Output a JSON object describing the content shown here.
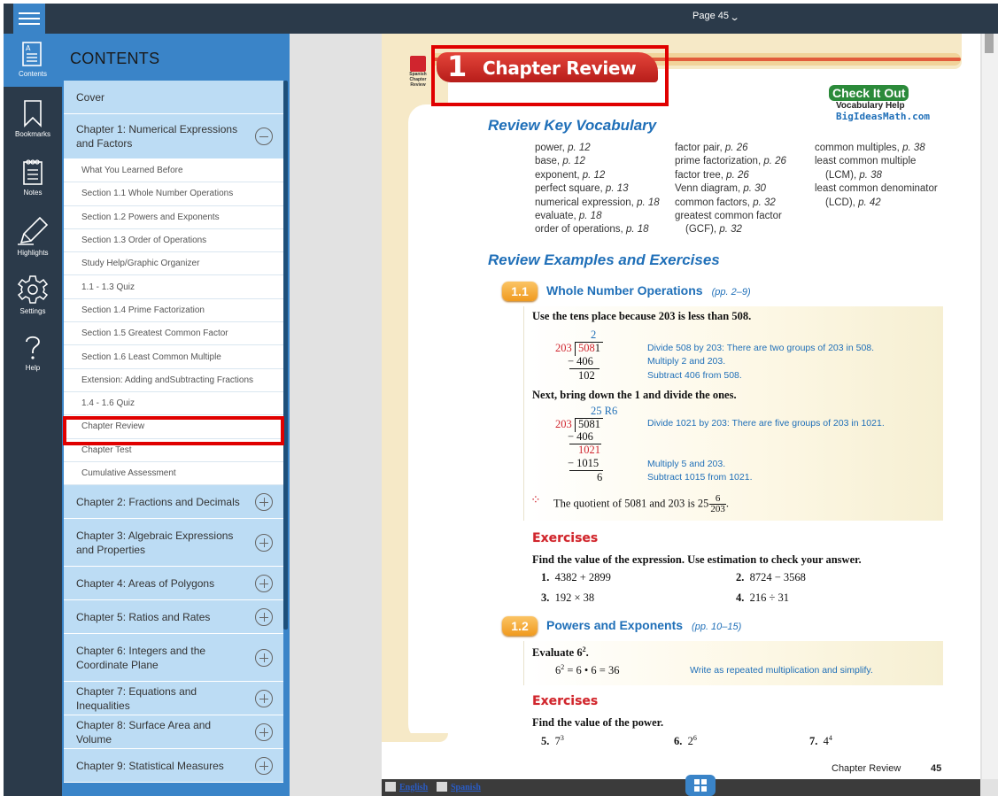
{
  "topbar": {
    "menu_icon": "hamburger-menu-icon",
    "page_label": "Page 45"
  },
  "rail": {
    "items": [
      {
        "label": "Contents",
        "icon": "contents-icon"
      },
      {
        "label": "Bookmarks",
        "icon": "bookmark-icon"
      },
      {
        "label": "Notes",
        "icon": "notes-icon"
      },
      {
        "label": "Highlights",
        "icon": "pencil-icon"
      },
      {
        "label": "Settings",
        "icon": "gear-icon"
      },
      {
        "label": "Help",
        "icon": "question-icon"
      }
    ],
    "active_color": "#3a84c8"
  },
  "contents": {
    "title": "CONTENTS",
    "cover": "Cover",
    "chapter1": {
      "label": "Chapter 1: Numerical Expressions and Factors",
      "sections": [
        "What You Learned Before",
        "Section 1.1 Whole Number Operations",
        "Section 1.2 Powers and Exponents",
        "Section 1.3 Order of Operations",
        "Study Help/Graphic Organizer",
        "1.1 - 1.3 Quiz",
        "Section 1.4 Prime Factorization",
        "Section 1.5 Greatest Common Factor",
        "Section 1.6 Least Common Multiple",
        "Extension: Adding andSubtracting Fractions",
        "1.4 - 1.6 Quiz",
        "Chapter Review",
        "Chapter Test",
        "Cumulative Assessment"
      ]
    },
    "chapters": [
      "Chapter 2: Fractions and Decimals",
      "Chapter 3: Algebraic Expressions and Properties",
      "Chapter 4: Areas of Polygons",
      "Chapter 5: Ratios and Rates",
      "Chapter 6: Integers and the Coordinate Plane",
      "Chapter 7: Equations and Inequalities",
      "Chapter 8: Surface Area and Volume",
      "Chapter 9: Statistical Measures"
    ],
    "highlighted_item": "Chapter Review"
  },
  "book_page": {
    "spanish_label": "Spanish Chapter Review",
    "chapter_number": "1",
    "chapter_title": "Chapter Review",
    "check_it_out": {
      "title": "Check It Out",
      "sub": "Vocabulary Help",
      "site": "BigIdeasMath.com"
    },
    "vocab_heading": "Review Key Vocabulary",
    "vocab": [
      [
        {
          "term": "power,",
          "page": "p. 12"
        },
        {
          "term": "base,",
          "page": "p. 12"
        },
        {
          "term": "exponent,",
          "page": "p. 12"
        },
        {
          "term": "perfect square,",
          "page": "p. 13"
        },
        {
          "term": "numerical expression,",
          "page": "p. 18"
        },
        {
          "term": "evaluate,",
          "page": "p. 18"
        },
        {
          "term": "order of operations,",
          "page": "p. 18"
        }
      ],
      [
        {
          "term": "factor pair,",
          "page": "p. 26"
        },
        {
          "term": "prime factorization,",
          "page": "p. 26"
        },
        {
          "term": "factor tree,",
          "page": "p. 26"
        },
        {
          "term": "Venn diagram,",
          "page": "p. 30"
        },
        {
          "term": "common factors,",
          "page": "p. 32"
        },
        {
          "term": "greatest common factor",
          "page": ""
        },
        {
          "term": "   (GCF),",
          "page": "p. 32"
        }
      ],
      [
        {
          "term": "common multiples,",
          "page": "p. 38"
        },
        {
          "term": "least common multiple",
          "page": ""
        },
        {
          "term": "   (LCM),",
          "page": "p. 38"
        },
        {
          "term": "least common denominator",
          "page": ""
        },
        {
          "term": "   (LCD),",
          "page": "p. 42"
        }
      ]
    ],
    "examples_heading": "Review Examples and Exercises",
    "lesson1": {
      "number": "1.1",
      "title": "Whole Number Operations",
      "pages": "(pp. 2–9)",
      "intro": "Use the tens place because 203 is less than 508.",
      "step1": {
        "quotient": "2",
        "divisor": "203",
        "dividend_lead": "508",
        "dividend_rest": "1",
        "sub": "− 406",
        "remainder": "102",
        "notes": [
          "Divide 508 by 203: There are two groups of 203 in 508.",
          "Multiply 2 and 203.",
          "Subtract 406 from 508."
        ]
      },
      "intro2": "Next, bring down the 1 and divide the ones.",
      "step2": {
        "quotient": "25 R6",
        "divisor": "203",
        "dividend": "5081",
        "sub1": "− 406",
        "brought": "1021",
        "sub2": "− 1015",
        "remainder": "6",
        "notes": [
          "Divide 1021 by 203: There are five groups of 203 in 1021.",
          "Multiply 5 and 203.",
          "Subtract 1015 from 1021."
        ]
      },
      "conclusion": "The quotient of 5081 and 203 is 25",
      "conclusion_frac_num": "6",
      "conclusion_frac_den": "203",
      "exercises_heading": "Exercises",
      "exercises_prompt": "Find the value of the expression. Use estimation to check your answer.",
      "exercises": [
        {
          "n": "1.",
          "expr": "4382 + 2899"
        },
        {
          "n": "2.",
          "expr": "8724 − 3568"
        },
        {
          "n": "3.",
          "expr": "192 × 38"
        },
        {
          "n": "4.",
          "expr": "216 ÷ 31"
        }
      ]
    },
    "lesson2": {
      "number": "1.2",
      "title": "Powers and Exponents",
      "pages": "(pp. 10–15)",
      "intro": "Evaluate 6",
      "intro_exp": "2",
      "work": "6",
      "work_exp": "2",
      "work_rest": " = 6 • 6 = 36",
      "note": "Write as repeated multiplication and simplify.",
      "exercises_heading": "Exercises",
      "exercises_prompt": "Find the value of the power.",
      "exercises": [
        {
          "n": "5.",
          "base": "7",
          "exp": "3"
        },
        {
          "n": "6.",
          "base": "2",
          "exp": "6"
        },
        {
          "n": "7.",
          "base": "4",
          "exp": "4"
        }
      ]
    },
    "footer_label": "Chapter Review",
    "footer_page": "45"
  },
  "bottom_bar": {
    "english": "English",
    "spanish": "Spanish",
    "grid_icon": "grid-icon"
  },
  "colors": {
    "topbar": "#2b3a4a",
    "accent": "#3a84c8",
    "toc_chapter_bg": "#bcdcf4",
    "highlight_box": "#e00000",
    "book_blue": "#1f6fb8",
    "book_red": "#d0252e"
  }
}
